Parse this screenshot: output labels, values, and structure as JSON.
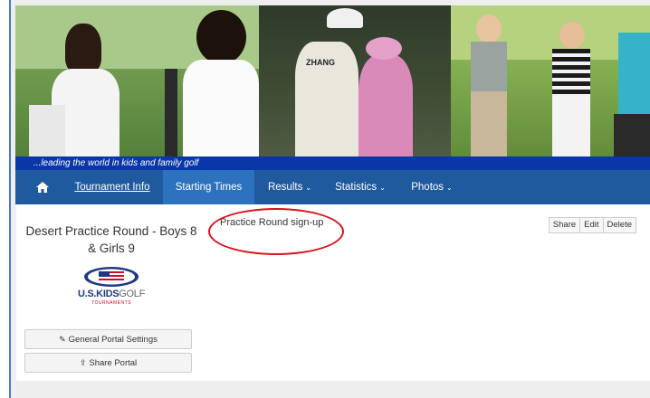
{
  "banner": {
    "jersey_text": "ZHANG",
    "tagline": "...leading the world in kids and family golf"
  },
  "nav": {
    "items": [
      {
        "label": "Tournament Info",
        "dropdown": false
      },
      {
        "label": "Starting Times",
        "dropdown": false,
        "active": true
      },
      {
        "label": "Results",
        "dropdown": true
      },
      {
        "label": "Statistics",
        "dropdown": true
      },
      {
        "label": "Photos",
        "dropdown": true
      }
    ],
    "home_icon": "home-icon",
    "caret": "⌄"
  },
  "portal": {
    "title": "Desert Practice Round - Boys 8 & Girls 9",
    "logo_text_main": "U.S.KIDS",
    "logo_text_golf": "GOLF",
    "logo_subtext": "TOURNAMENTS"
  },
  "sheet": {
    "title": "Practice Round sign-up"
  },
  "actions": {
    "share": "Share",
    "edit": "Edit",
    "delete": "Delete"
  },
  "buttons": {
    "settings": "General Portal Settings",
    "share_portal": "Share Portal"
  },
  "colors": {
    "tagline_bg": "#0a37a8",
    "nav_bg": "#1f5a9e",
    "nav_active": "#2c72bf",
    "annotation": "#d8131f"
  }
}
